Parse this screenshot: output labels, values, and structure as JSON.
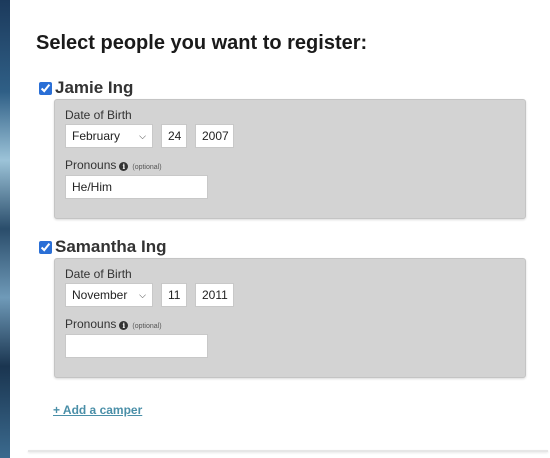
{
  "title": "Select people you want to register:",
  "people": [
    {
      "name": "Jamie Ing",
      "checked": true,
      "dob_label": "Date of Birth",
      "month": "February",
      "day": "24",
      "year": "2007",
      "pronouns_label": "Pronouns",
      "optional_label": "(optional)",
      "pronouns_value": "He/Him"
    },
    {
      "name": "Samantha Ing",
      "checked": true,
      "dob_label": "Date of Birth",
      "month": "November",
      "day": "11",
      "year": "2011",
      "pronouns_label": "Pronouns",
      "optional_label": "(optional)",
      "pronouns_value": ""
    }
  ],
  "add_camper_label": "+ Add a camper",
  "icons": {
    "info": "info-icon",
    "dropdown": "chevron-down-icon"
  },
  "colors": {
    "card_bg": "#d3d3d3",
    "link": "#4a8fa8",
    "checkbox": "#2a6fd6"
  }
}
